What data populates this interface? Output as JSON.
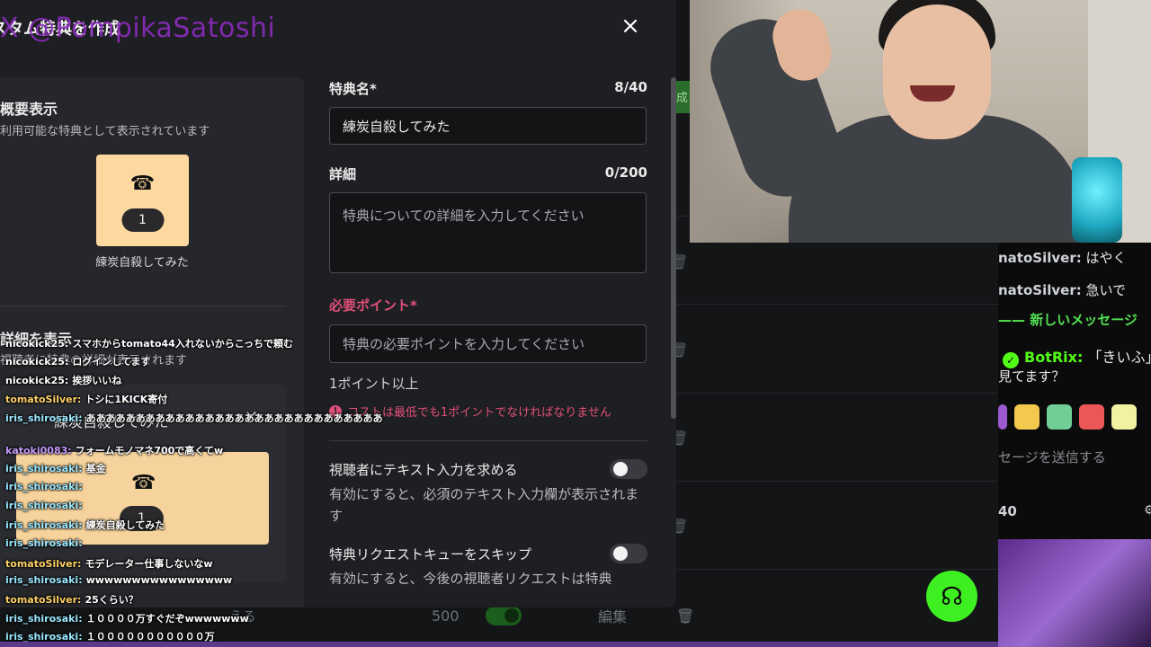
{
  "modal": {
    "title": "スタム特典を作成",
    "close_label": "×",
    "watermark": "X @PompikaSatoshi"
  },
  "preview": {
    "section_title": "概要表示",
    "section_sub": "利用可能な特典として表示されています",
    "card_count": "1",
    "card_name": "練炭自殺してみた",
    "detail_title": "詳細を表示",
    "detail_sub": "視聴者に特典の詳細が表示されます",
    "detail_card_title": "練炭自殺してみた",
    "detail_card_count": "1"
  },
  "form": {
    "name_label": "特典名*",
    "name_count": "8/40",
    "name_value": "練炭自殺してみた",
    "detail_label": "詳細",
    "detail_count": "0/200",
    "detail_placeholder": "特典についての詳細を入力してください",
    "points_label": "必要ポイント*",
    "points_placeholder": "特典の必要ポイントを入力してください",
    "points_helper": "1ポイント以上",
    "points_error": "コストは最低でも1ポイントでなければなりません",
    "toggle1_title": "視聴者にテキスト入力を求める",
    "toggle1_desc": "有効にすると、必須のテキスト入力欄が表示されます",
    "toggle2_title": "特典リクエストキューをスキップ",
    "toggle2_desc": "有効にすると、今後の視聴者リクエストは特典"
  },
  "background": {
    "bottom_text": "える",
    "bottom_points": "500",
    "bottom_edit": "編集",
    "side_tab": "成"
  },
  "chat": {
    "lines": [
      {
        "user": "natoSilver:",
        "text": "はやく"
      },
      {
        "user": "natoSilver:",
        "text": "急いで"
      }
    ],
    "new_messages": "—— 新しいメッセージ",
    "bot_name": "BotRix:",
    "bot_text": "「きいふ」",
    "bot_text2": "見てます？",
    "input_placeholder": "セージを送信する",
    "count": "40"
  },
  "overlay_chat": [
    {
      "user": "nicokick25:",
      "text": "スマホからtomato44入れないからこっちで頼む",
      "color": "#ffffff"
    },
    {
      "user": "nicokick25:",
      "text": "ログインしてます",
      "color": "#ffffff"
    },
    {
      "user": "nicokick25:",
      "text": "挨拶いいね",
      "color": "#ffffff"
    },
    {
      "user": "tomatoSilver:",
      "text": "トシに1KICK寄付",
      "color": "#ffd166"
    },
    {
      "user": "iris_shirosaki:",
      "text": "ああああああああああああああああああああああああああああああ",
      "color": "#9be7ff"
    },
    {
      "user": "katoki0083:",
      "text": "フォームモノマネ700で高くてw",
      "color": "#c79bff"
    },
    {
      "user": "iris_shirosaki:",
      "text": "基金",
      "color": "#9be7ff"
    },
    {
      "user": "iris_shirosaki:",
      "text": "",
      "color": "#9be7ff"
    },
    {
      "user": "iris_shirosaki:",
      "text": "",
      "color": "#9be7ff"
    },
    {
      "user": "iris_shirosaki:",
      "text": "練炭自殺してみた",
      "color": "#9be7ff"
    },
    {
      "user": "iris_shirosaki:",
      "text": "",
      "color": "#9be7ff"
    },
    {
      "user": "tomatoSilver:",
      "text": "モデレーター仕事しないなw",
      "color": "#ffd166"
    },
    {
      "user": "iris_shirosaki:",
      "text": "wwwwwwwwwwwwwwww",
      "color": "#9be7ff"
    },
    {
      "user": "tomatoSilver:",
      "text": "25くらい？",
      "color": "#ffd166"
    },
    {
      "user": "iris_shirosaki:",
      "text": "１００００万すぐだぞwwwwwww",
      "color": "#9be7ff"
    },
    {
      "user": "iris_shirosaki:",
      "text": "１０００００００００００万",
      "color": "#9be7ff"
    }
  ],
  "colors": {
    "accent_green": "#53fc18",
    "required_pink": "#e0507a",
    "card_bg": "#fdd9a0"
  }
}
